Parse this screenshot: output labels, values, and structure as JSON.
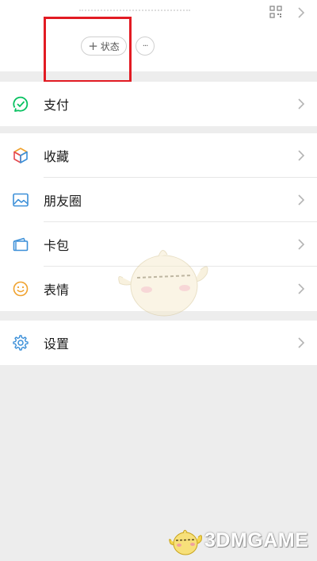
{
  "profile": {
    "status_button_label": "状态",
    "status_button_plus": "+",
    "more_button_label": "···"
  },
  "menu": {
    "pay": {
      "label": "支付",
      "icon": "pay-icon"
    },
    "favorites": {
      "label": "收藏",
      "icon": "favorites-cube-icon"
    },
    "moments": {
      "label": "朋友圈",
      "icon": "moments-image-icon"
    },
    "cards": {
      "label": "卡包",
      "icon": "card-wallet-icon"
    },
    "stickers": {
      "label": "表情",
      "icon": "smiley-icon"
    },
    "settings": {
      "label": "设置",
      "icon": "gear-icon"
    }
  },
  "watermark": {
    "text": "3DMGAME"
  },
  "colors": {
    "background": "#ededed",
    "highlight_box": "#e21b23",
    "pay_green": "#07c160",
    "moments_blue": "#3b8fd8"
  }
}
